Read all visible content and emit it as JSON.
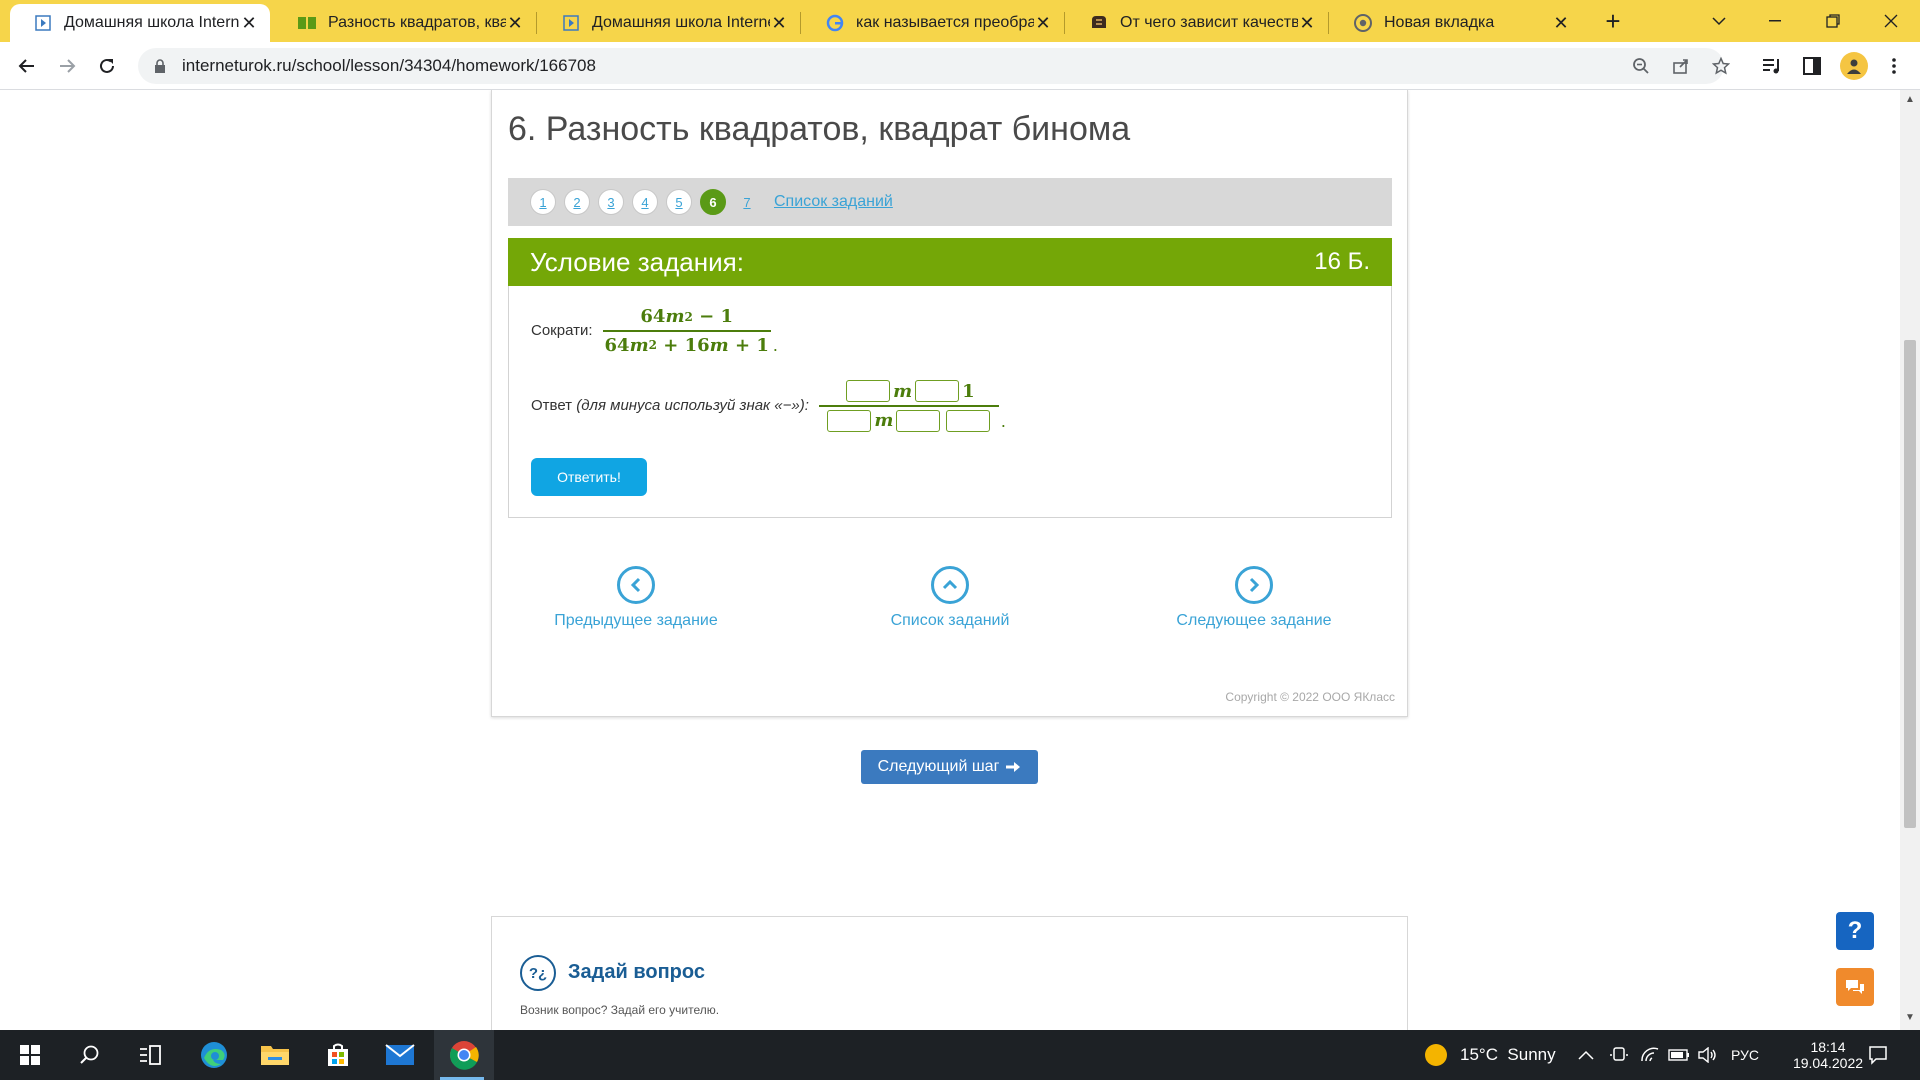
{
  "browser": {
    "tabs": [
      {
        "title": "Домашняя школа Internet",
        "icon": "play-square-icon",
        "active": true
      },
      {
        "title": "Разность квадратов, квадр",
        "icon": "book-icon",
        "active": false
      },
      {
        "title": "Домашняя школа Internet",
        "icon": "play-square-icon",
        "active": false
      },
      {
        "title": "как называется преобразо",
        "icon": "google-icon",
        "active": false
      },
      {
        "title": "От чего зависит качество",
        "icon": "brain-icon",
        "active": false
      },
      {
        "title": "Новая вкладка",
        "icon": "chrome-icon",
        "active": false
      }
    ],
    "url": "interneturok.ru/school/lesson/34304/homework/166708"
  },
  "page": {
    "lesson_title": "6. Разность квадратов, квадрат бинома",
    "task_numbers": [
      "1",
      "2",
      "3",
      "4",
      "5",
      "6",
      "7"
    ],
    "current_task": "6",
    "task_list_link": "Список заданий",
    "condition_title": "Условие задания:",
    "points": "16 Б.",
    "prompt_label": "Сократи:",
    "fraction": {
      "num_coef": "64",
      "num_var": "m",
      "num_exp": "2",
      "num_rest": "− 1",
      "den_coef": "64",
      "den_var": "m",
      "den_exp": "2",
      "den_mid": "+ 16",
      "den_var2": "m",
      "den_rest": "+ 1"
    },
    "answer_label": "Ответ",
    "answer_hint": "(для минуса используй знак «−»):",
    "answer_template": {
      "var": "m",
      "num_const": "1"
    },
    "answer_button": "Ответить!",
    "nav": {
      "prev": "Предыдущее задание",
      "list": "Список заданий",
      "next": "Следующее задание"
    },
    "copyright": "Copyright © 2022 ООО ЯКласс",
    "next_step_button": "Следующий шаг",
    "ask": {
      "title": "Задай вопрос",
      "subtitle": "Возник вопрос? Задай его учителю."
    }
  },
  "taskbar": {
    "weather": "15°C  Sunny",
    "lang": "РУС",
    "time": "18:14",
    "date": "19.04.2022"
  },
  "colors": {
    "tabbar": "#f6d54a",
    "green_header": "#74a707",
    "link_blue": "#3aa3d6",
    "answer_button": "#10a5e3",
    "next_step": "#3b7abf"
  }
}
